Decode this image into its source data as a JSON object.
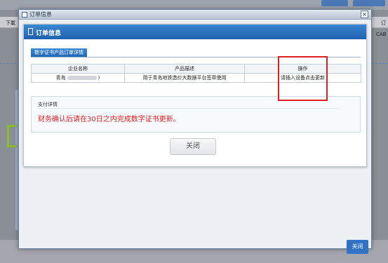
{
  "background": {
    "left_label": "下載",
    "right_label": "订",
    "right_label_2": "CAB"
  },
  "outer_dialog": {
    "title": "订单信息",
    "close_glyph": "×"
  },
  "inner_dialog": {
    "title": "订单信息",
    "tab_label": "数字证书产品订单详情",
    "table": {
      "headers": [
        "企业名称",
        "产品描述",
        "操作"
      ],
      "rows": [
        {
          "company_prefix": "青岛",
          "company_suffix": ")",
          "description": "用于青岛地铁造价大数据平台签章使用",
          "action": "请插入设备点击更新"
        }
      ]
    },
    "payment": {
      "title": "支付详情",
      "message": "财务确认后请在30日之内完成数字证书更新。"
    },
    "close_button": "关闭"
  },
  "footer": {
    "close_button": "关闭"
  },
  "colors": {
    "header_blue": "#1d61ad",
    "alert_red": "#e02020",
    "button_blue": "#2f72c6"
  }
}
